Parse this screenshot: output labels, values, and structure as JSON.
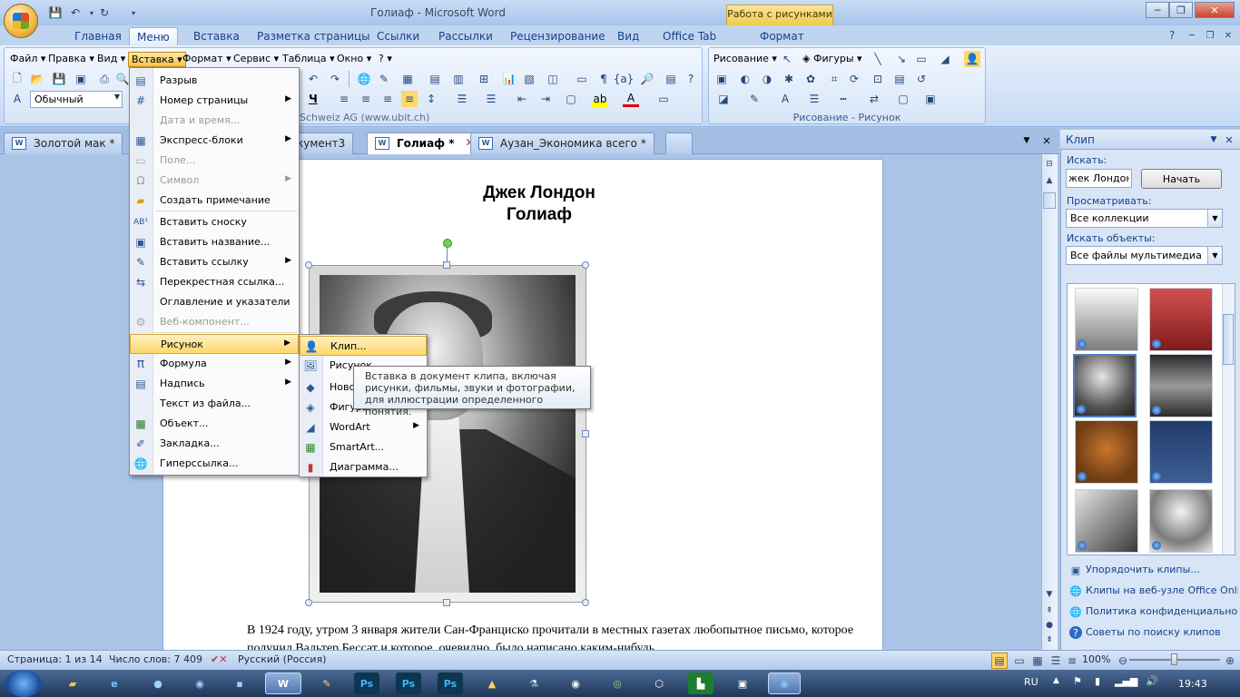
{
  "window": {
    "title": "Голиаф - Microsoft Word",
    "context_tab_title": "Работа с рисунками"
  },
  "ribbon_tabs": [
    "Главная",
    "Меню",
    "Вставка",
    "Разметка страницы",
    "Ссылки",
    "Рассылки",
    "Рецензирование",
    "Вид",
    "Office Tab",
    "Формат"
  ],
  "menubar": [
    "Файл",
    "Правка",
    "Вид",
    "Вставка",
    "Формат",
    "Сервис",
    "Таблица",
    "Окно",
    "?"
  ],
  "toolbar": {
    "style_value": "Обычный",
    "ubit_text": "Schweiz AG    (www.ubit.ch)"
  },
  "drawing_panel": {
    "draw_label": "Рисование",
    "shapes_label": "Фигуры",
    "caption": "Рисование - Рисунок"
  },
  "doc_tabs": [
    {
      "label": "Золотой мак *"
    },
    {
      "label": "кумент3"
    },
    {
      "label": "Голиаф *"
    },
    {
      "label": "Аузан_Экономика всего *"
    }
  ],
  "document": {
    "title_line1": "Джек Лондон",
    "title_line2": "Голиаф",
    "body": "В 1924 году, утром 3 января жители Сан-Франциско прочитали в местных газетах любопытное письмо, которое получил Вальтер Бессат и которое, очевидно, было написано каким-нибудь"
  },
  "insert_menu": [
    {
      "label": "Разрыв",
      "icon": "page-break-icon",
      "disabled": false,
      "submenu": false
    },
    {
      "label": "Номер страницы",
      "icon": "page-number-icon",
      "disabled": false,
      "submenu": true
    },
    {
      "label": "Дата и время...",
      "icon": "",
      "disabled": true,
      "submenu": false
    },
    {
      "label": "Экспресс-блоки",
      "icon": "quick-parts-icon",
      "disabled": false,
      "submenu": true
    },
    {
      "label": "Поле...",
      "icon": "field-icon",
      "disabled": true,
      "submenu": false
    },
    {
      "label": "Символ",
      "icon": "omega-icon",
      "disabled": true,
      "submenu": true
    },
    {
      "label": "Создать примечание",
      "icon": "comment-icon",
      "disabled": false,
      "submenu": false
    },
    {
      "label": "Вставить сноску",
      "icon": "footnote-icon",
      "disabled": false,
      "submenu": false
    },
    {
      "label": "Вставить название...",
      "icon": "caption-icon",
      "disabled": false,
      "submenu": false
    },
    {
      "label": "Вставить ссылку",
      "icon": "citation-icon",
      "disabled": false,
      "submenu": true
    },
    {
      "label": "Перекрестная ссылка...",
      "icon": "cross-reference-icon",
      "disabled": false,
      "submenu": false
    },
    {
      "label": "Оглавление и указатели",
      "icon": "",
      "disabled": false,
      "submenu": false
    },
    {
      "label": "Веб-компонент...",
      "icon": "web-component-icon",
      "disabled": true,
      "submenu": false
    },
    {
      "label": "Рисунок",
      "icon": "",
      "disabled": false,
      "submenu": true,
      "highlighted": true
    },
    {
      "label": "Формула",
      "icon": "pi-icon",
      "disabled": false,
      "submenu": true
    },
    {
      "label": "Надпись",
      "icon": "textbox-icon",
      "disabled": false,
      "submenu": true
    },
    {
      "label": "Текст из файла...",
      "icon": "",
      "disabled": false,
      "submenu": false
    },
    {
      "label": "Объект...",
      "icon": "object-icon",
      "disabled": false,
      "submenu": false
    },
    {
      "label": "Закладка...",
      "icon": "bookmark-icon",
      "disabled": false,
      "submenu": false
    },
    {
      "label": "Гиперссылка...",
      "icon": "hyperlink-icon",
      "disabled": false,
      "submenu": false
    }
  ],
  "picture_submenu": [
    {
      "label": "Клип...",
      "icon": "clip-art-icon",
      "highlighted": true
    },
    {
      "label": "Рисунок",
      "icon": "picture-icon"
    },
    {
      "label": "Новое",
      "icon": "new-drawing-icon"
    },
    {
      "label": "Фигуры",
      "icon": "shapes-icon"
    },
    {
      "label": "WordArt",
      "icon": "wordart-icon",
      "submenu": true
    },
    {
      "label": "SmartArt...",
      "icon": "smartart-icon"
    },
    {
      "label": "Диаграмма...",
      "icon": "chart-icon"
    }
  ],
  "tooltip": "Вставка в документ клипа, включая рисунки, фильмы, звуки и фотографии, для иллюстрации определенного понятия.",
  "clip_pane": {
    "title": "Клип",
    "search_label": "Искать:",
    "search_value": "жек Лондон",
    "go_button": "Начать",
    "browse_label": "Просматривать:",
    "browse_value": "Все коллекции",
    "objects_label": "Искать объекты:",
    "objects_value": "Все файлы мультимедиа",
    "links": [
      {
        "label": "Упорядочить клипы...",
        "icon": "organize-clips-icon"
      },
      {
        "label": "Клипы на веб-узле Office Online",
        "icon": "office-online-icon"
      },
      {
        "label": "Политика конфиденциальности M",
        "icon": "privacy-icon"
      },
      {
        "label": "Советы по поиску клипов",
        "icon": "help-icon"
      }
    ]
  },
  "statusbar": {
    "page": "Страница: 1 из 14",
    "words": "Число слов: 7 409",
    "language": "Русский (Россия)",
    "zoom": "100%",
    "zoom_level": 1.0
  },
  "taskbar": {
    "lang": "RU",
    "time": "19:43"
  }
}
